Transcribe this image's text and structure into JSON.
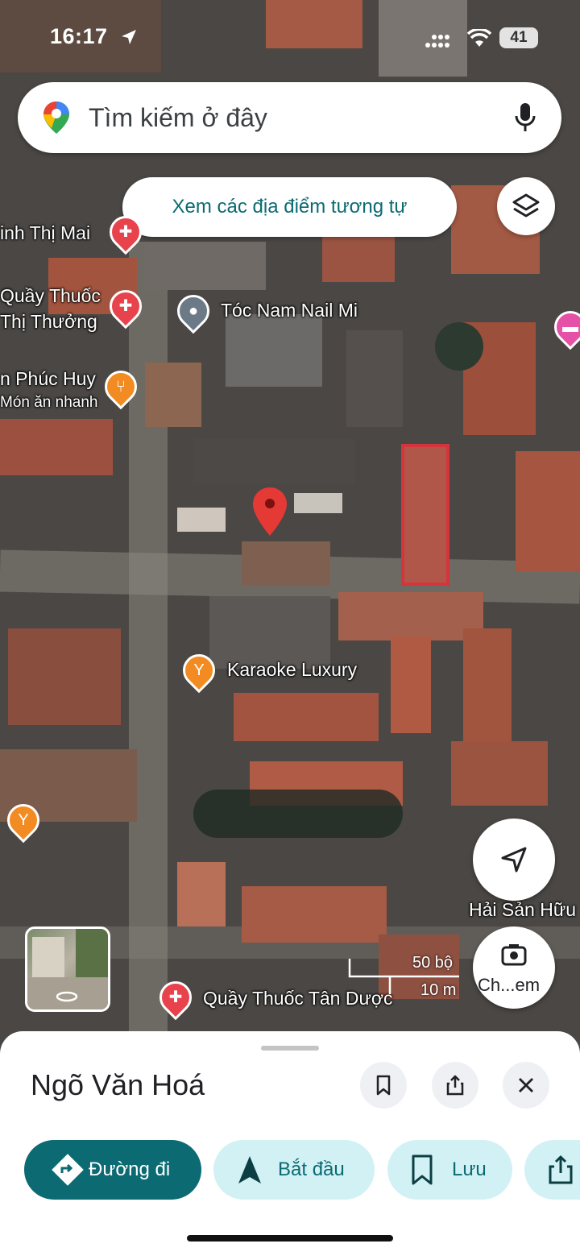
{
  "status_bar": {
    "time": "16:17",
    "battery": "41"
  },
  "search": {
    "placeholder": "Tìm kiếm ở đây"
  },
  "chips": {
    "similar_places": "Xem các địa điểm tương tự"
  },
  "map_labels": {
    "poi_1": "inh Thị Mai",
    "poi_2_line1": "Quầy Thuốc",
    "poi_2_line2": "Thị Thưởng",
    "poi_3": "Tóc Nam Nail Mi",
    "poi_4_line1": "n Phúc Huy",
    "poi_4_line2": "Món ăn nhanh",
    "poi_5": "Karaoke Luxury",
    "poi_6": "Hải Sản Hữu",
    "poi_7": "Quầy Thuốc Tân Dược"
  },
  "scale": {
    "imperial": "50 bộ",
    "metric": "10 m"
  },
  "camera_fab_label": "Ch...em",
  "sheet": {
    "title": "Ngõ Văn Hoá",
    "actions": {
      "directions": "Đường đi",
      "start": "Bắt đầu",
      "save": "Lưu"
    }
  },
  "colors": {
    "accent": "#0b6a72",
    "action_bg": "#d2f1f5",
    "primary_btn": "#0b6a72",
    "pin_red": "#e53935",
    "poi_orange": "#f28b21",
    "poi_red": "#e8434d",
    "poi_pink": "#e451a6"
  },
  "icons": [
    "google-maps-pin-icon",
    "mic-icon",
    "layers-icon",
    "location-arrow-icon",
    "camera-search-icon",
    "bookmark-icon",
    "share-icon",
    "close-icon",
    "directions-icon",
    "navigation-icon"
  ]
}
